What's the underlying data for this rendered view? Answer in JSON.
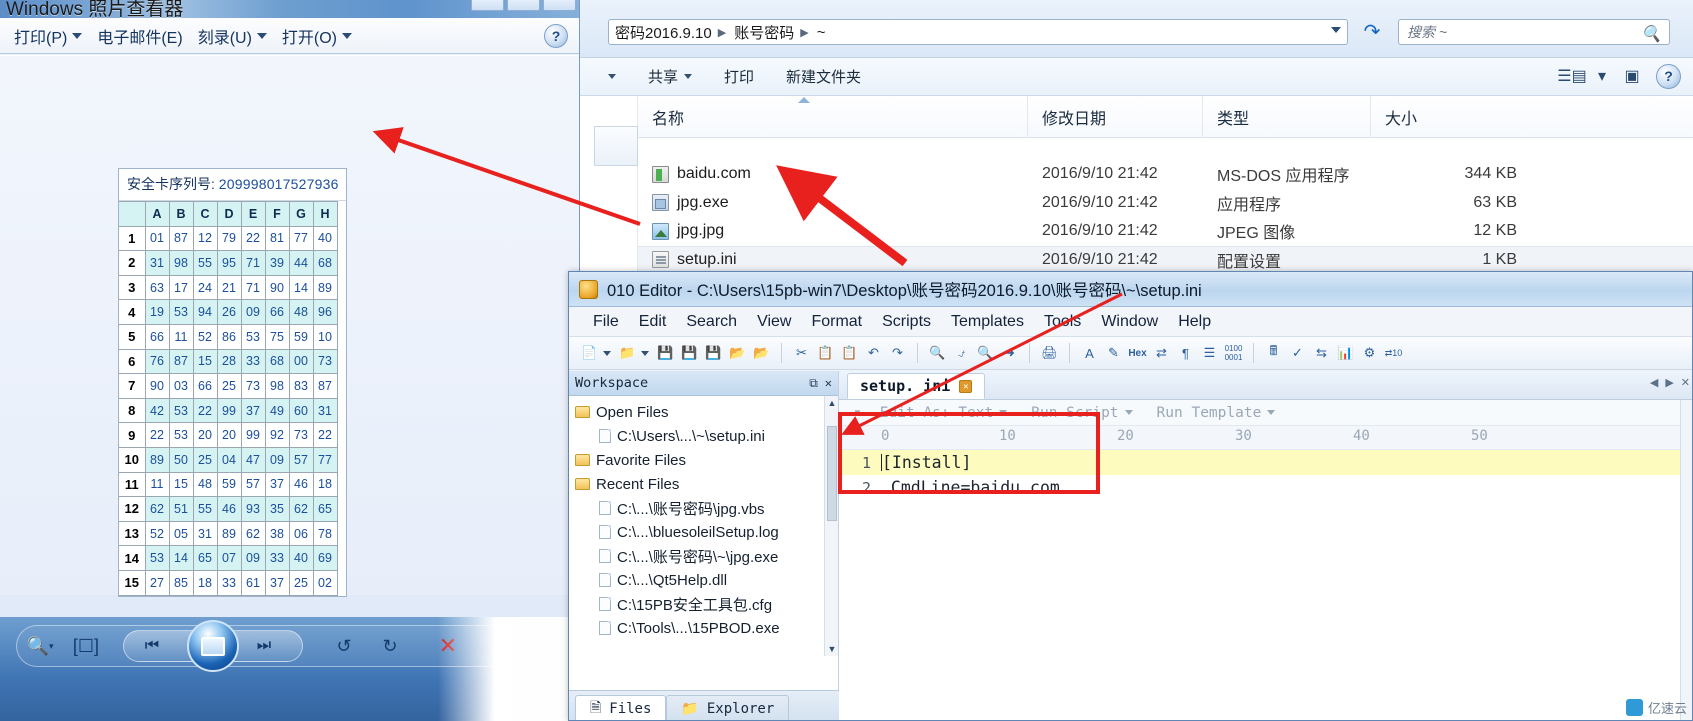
{
  "photo_viewer": {
    "title": "Windows 照片查看器",
    "toolbar": [
      {
        "label": "打印(P)",
        "caret": true
      },
      {
        "label": "电子邮件(E)",
        "caret": false
      },
      {
        "label": "刻录(U)",
        "caret": true
      },
      {
        "label": "打开(O)",
        "caret": true
      }
    ],
    "help_icon": "?",
    "bottom_bar": {
      "zoom_icon": "zoom-in-icon",
      "fit_icon": "fit-to-window-icon",
      "prev_icon": "previous-icon",
      "play_icon": "slideshow-icon",
      "next_icon": "next-icon",
      "rotate_ccw_icon": "rotate-counterclockwise-icon",
      "rotate_cw_icon": "rotate-clockwise-icon",
      "delete_icon": "delete-icon"
    }
  },
  "security_card": {
    "serial_label": "安全卡序列号:",
    "serial_value": "209998017527936",
    "columns": [
      "A",
      "B",
      "C",
      "D",
      "E",
      "F",
      "G",
      "H"
    ],
    "rows": [
      {
        "n": "1",
        "v": [
          "01",
          "87",
          "12",
          "79",
          "22",
          "81",
          "77",
          "40"
        ]
      },
      {
        "n": "2",
        "v": [
          "31",
          "98",
          "55",
          "95",
          "71",
          "39",
          "44",
          "68"
        ]
      },
      {
        "n": "3",
        "v": [
          "63",
          "17",
          "24",
          "21",
          "71",
          "90",
          "14",
          "89"
        ]
      },
      {
        "n": "4",
        "v": [
          "19",
          "53",
          "94",
          "26",
          "09",
          "66",
          "48",
          "96"
        ]
      },
      {
        "n": "5",
        "v": [
          "66",
          "11",
          "52",
          "86",
          "53",
          "75",
          "59",
          "10"
        ]
      },
      {
        "n": "6",
        "v": [
          "76",
          "87",
          "15",
          "28",
          "33",
          "68",
          "00",
          "73"
        ]
      },
      {
        "n": "7",
        "v": [
          "90",
          "03",
          "66",
          "25",
          "73",
          "98",
          "83",
          "87"
        ]
      },
      {
        "n": "8",
        "v": [
          "42",
          "53",
          "22",
          "99",
          "37",
          "49",
          "60",
          "31"
        ]
      },
      {
        "n": "9",
        "v": [
          "22",
          "53",
          "20",
          "20",
          "99",
          "92",
          "73",
          "22"
        ]
      },
      {
        "n": "10",
        "v": [
          "89",
          "50",
          "25",
          "04",
          "47",
          "09",
          "57",
          "77"
        ]
      },
      {
        "n": "11",
        "v": [
          "11",
          "15",
          "48",
          "59",
          "57",
          "37",
          "46",
          "18"
        ]
      },
      {
        "n": "12",
        "v": [
          "62",
          "51",
          "55",
          "46",
          "93",
          "35",
          "62",
          "65"
        ]
      },
      {
        "n": "13",
        "v": [
          "52",
          "05",
          "31",
          "89",
          "62",
          "38",
          "06",
          "78"
        ]
      },
      {
        "n": "14",
        "v": [
          "53",
          "14",
          "65",
          "07",
          "09",
          "33",
          "40",
          "69"
        ]
      },
      {
        "n": "15",
        "v": [
          "27",
          "85",
          "18",
          "33",
          "61",
          "37",
          "25",
          "02"
        ]
      }
    ]
  },
  "explorer": {
    "breadcrumbs": [
      "密码2016.9.10",
      "账号密码",
      "~"
    ],
    "address_caret_icon": "chevron-down-icon",
    "refresh_icon": "refresh-icon",
    "search": {
      "placeholder": "搜索 ~",
      "value": "",
      "icon": "search-icon"
    },
    "command_bar": [
      {
        "label": "",
        "caret": true
      },
      {
        "label": "共享",
        "caret": true
      },
      {
        "label": "打印",
        "caret": false
      },
      {
        "label": "新建文件夹",
        "caret": false
      }
    ],
    "view_buttons": {
      "change_view_icon": "change-view-icon",
      "view_caret_icon": "chevron-down-icon",
      "preview_pane_icon": "preview-pane-icon",
      "help_icon": "?"
    },
    "columns": [
      "名称",
      "修改日期",
      "类型",
      "大小"
    ],
    "files": [
      {
        "name": "baidu.com",
        "date": "2016/9/10 21:42",
        "type": "MS-DOS 应用程序",
        "size": "344 KB",
        "icon": "dos-app-icon",
        "selected": false
      },
      {
        "name": "jpg.exe",
        "date": "2016/9/10 21:42",
        "type": "应用程序",
        "size": "63 KB",
        "icon": "exe-app-icon",
        "selected": false
      },
      {
        "name": "jpg.jpg",
        "date": "2016/9/10 21:42",
        "type": "JPEG 图像",
        "size": "12 KB",
        "icon": "jpeg-image-icon",
        "selected": false
      },
      {
        "name": "setup.ini",
        "date": "2016/9/10 21:42",
        "type": "配置设置",
        "size": "1 KB",
        "icon": "ini-config-icon",
        "selected": true
      }
    ]
  },
  "editor": {
    "title": "010 Editor - C:\\Users\\15pb-win7\\Desktop\\账号密码2016.9.10\\账号密码\\~\\setup.ini",
    "app_icon": "010-editor-icon",
    "menus": [
      "File",
      "Edit",
      "Search",
      "View",
      "Format",
      "Scripts",
      "Templates",
      "Tools",
      "Window",
      "Help"
    ],
    "toolbar_icons": [
      "new-file-icon",
      "new-file-caret",
      "open-file-icon",
      "open-file-caret",
      "save-icon",
      "save-as-icon",
      "save-all-icon",
      "open-folder-icon",
      "close-file-icon",
      "cut-icon",
      "copy-icon",
      "paste-icon",
      "undo-icon",
      "redo-icon",
      "find-icon",
      "replace-icon",
      "find-in-files-icon",
      "goto-icon",
      "print-icon",
      "font-icon",
      "highlight-icon",
      "hex-icon",
      "byte-swap-icon",
      "paragraph-icon",
      "column-mode-icon",
      "binary-icon",
      "calculator-icon",
      "checksum-icon",
      "compare-icon",
      "histogram-icon",
      "converter-icon",
      "base-convert-icon"
    ],
    "workspace": {
      "title": "Workspace",
      "float_icon": "float-pane-icon",
      "close_icon": "close-icon",
      "groups": [
        {
          "label": "Open Files",
          "icon": "folder-open-icon",
          "children": [
            "C:\\Users\\...\\~\\setup.ini"
          ]
        },
        {
          "label": "Favorite Files",
          "icon": "folder-favorite-icon",
          "children": []
        },
        {
          "label": "Recent Files",
          "icon": "folder-recent-icon",
          "children": [
            "C:\\...\\账号密码\\jpg.vbs",
            "C:\\...\\bluesoleilSetup.log",
            "C:\\...\\账号密码\\~\\jpg.exe",
            "C:\\...\\Qt5Help.dll",
            "C:\\15PB安全工具包.cfg",
            "C:\\Tools\\...\\15PBOD.exe"
          ]
        }
      ],
      "tabs": [
        {
          "label": "Files",
          "icon": "files-icon",
          "active": true
        },
        {
          "label": "Explorer",
          "icon": "folder-icon",
          "active": false
        }
      ]
    },
    "document": {
      "tab_label": "setup. ini",
      "tab_close_icon": "close-icon",
      "options": [
        {
          "label": "Edit As: Text",
          "caret": true
        },
        {
          "label": "Run Script",
          "caret": true
        },
        {
          "label": "Run Template",
          "caret": true
        }
      ],
      "ruler_ticks": [
        "0",
        "10",
        "20",
        "30",
        "40",
        "50"
      ],
      "lines": [
        {
          "num": "1",
          "text": "[Install]",
          "highlight": true
        },
        {
          "num": "2",
          "text": "CmdLine=baidu.com",
          "highlight": false
        }
      ]
    }
  },
  "annotations": {
    "highlight_rect_color": "#e8201e",
    "arrow_color": "#e8201e"
  },
  "watermark": {
    "text": "亿速云",
    "logo_icon": "brand-logo-icon"
  }
}
